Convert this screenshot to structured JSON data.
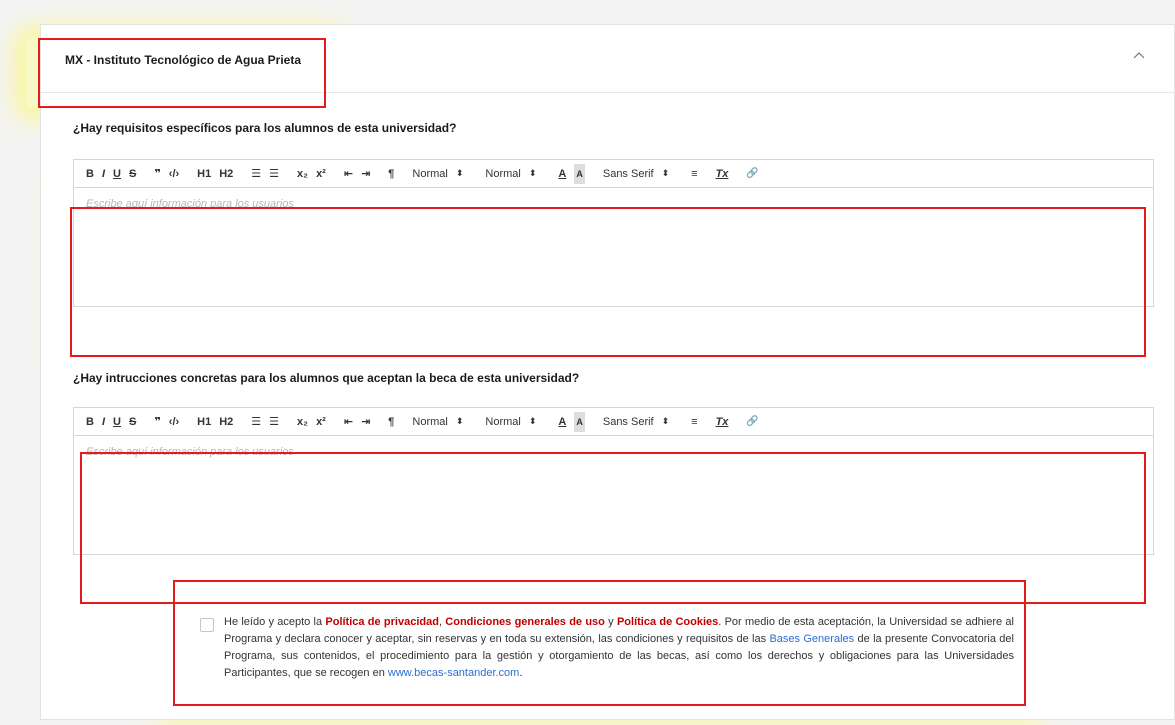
{
  "section": {
    "title": "MX - Instituto Tecnológico de Agua Prieta",
    "collapse_icon": "chevron-up-icon"
  },
  "question1": {
    "label": "¿Hay requisitos específicos para los alumnos de esta universidad?",
    "placeholder": "Escribe aquí información para los usuarios"
  },
  "question2": {
    "label": "¿Hay intrucciones concretas para los alumnos que aceptan la beca de esta universidad?",
    "placeholder": "Escribe aquí información para los usuarios"
  },
  "toolbar": {
    "bold": "B",
    "italic": "I",
    "underline": "U",
    "strike": "S",
    "blockquote": "❞",
    "code": "‹/›",
    "h1": "H1",
    "h2": "H2",
    "ordered_list": "☰",
    "bullet_list": "☰",
    "subscript": "x₂",
    "superscript": "x²",
    "indent_decrease": "⇤",
    "indent_increase": "⇥",
    "direction": "¶",
    "size_label": "Normal",
    "header_label": "Normal",
    "color": "A",
    "background": "A",
    "font_label": "Sans Serif",
    "align": "≡",
    "clean": "Tx",
    "link": "🔗",
    "select_arrows": "⬍"
  },
  "consent": {
    "text_1": "He leído y acepto la ",
    "privacy": "Política de privacidad",
    "comma": ", ",
    "conditions": "Condiciones generales de uso",
    "and": " y ",
    "cookies": "Política de Cookies",
    "text_2": ". Por medio de esta aceptación, la Universidad se adhiere al Programa y declara conocer y aceptar, sin reservas y en toda su extensión, las condiciones y requisitos de las ",
    "bases": "Bases Generales",
    "text_3": " de la presente Convocatoria del Programa, sus contenidos, el procedimiento para la gestión y otorgamiento de las becas, así como los derechos y obligaciones para las Universidades Participantes, que se recogen en ",
    "site": "www.becas-santander.com",
    "text_4": "."
  }
}
